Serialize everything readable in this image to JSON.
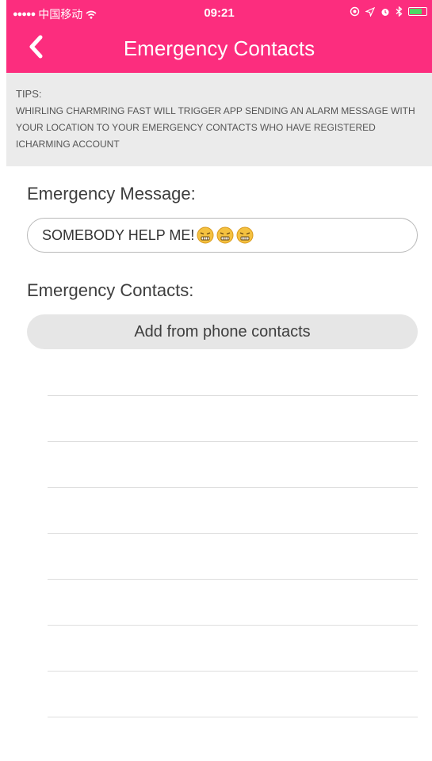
{
  "status_bar": {
    "carrier": "中国移动",
    "signal": "●●●●●",
    "time": "09:21"
  },
  "nav": {
    "title": "Emergency Contacts",
    "back_icon": "chevron-left-icon"
  },
  "tips": {
    "title": "TIPS:",
    "body": "WHIRLING CHARMRING FAST WILL TRIGGER APP SENDING AN ALARM MESSAGE WITH YOUR LOCATION TO YOUR EMERGENCY CONTACTS WHO HAVE REGISTERED ICHARMING ACCOUNT"
  },
  "message": {
    "label": "Emergency Message:",
    "value": "SOMEBODY HELP ME!",
    "emoji_icons": [
      "worried-face-icon",
      "worried-face-icon",
      "worried-face-icon"
    ]
  },
  "contacts": {
    "label": "Emergency Contacts:",
    "add_button": "Add from phone contacts",
    "slots": [
      "",
      "",
      "",
      "",
      "",
      "",
      "",
      ""
    ]
  },
  "colors": {
    "brand_pink": "#fc2d7e",
    "tips_background": "#ebebeb",
    "button_background": "#e6e6e6"
  }
}
